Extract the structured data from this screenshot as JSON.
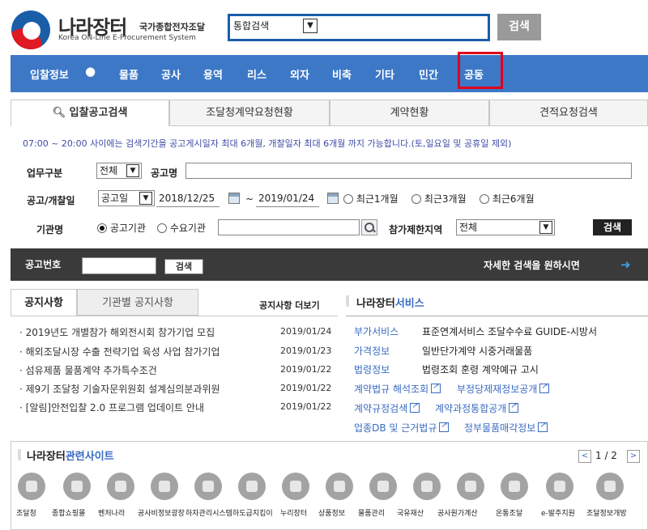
{
  "header": {
    "logo_title": "나라장터",
    "logo_subtitle": "국가종합전자조달",
    "logo_english": "Korea ON-Line E-Procurement System",
    "search_select": "통합검색",
    "search_value": "",
    "search_button": "검색"
  },
  "nav": {
    "items": [
      "입찰정보",
      "물품",
      "공사",
      "용역",
      "리스",
      "외자",
      "비축",
      "기타",
      "민간",
      "공동"
    ],
    "highlighted": "공동",
    "bg_color": "#3d78c7",
    "highlight_color": "#e0001b"
  },
  "tabs": [
    "입찰공고검색",
    "조달청계약요청현황",
    "계약현황",
    "견적요청검색"
  ],
  "search_panel": {
    "notice": "07:00 ~ 20:00 사이에는 검색기간을 공고게시일자 최대 6개월, 개찰일자 최대 6개월 까지 가능합니다.(토,일요일 및 공휴일 제외)",
    "biz_label": "업무구분",
    "biz_value": "전체",
    "title_label": "공고명",
    "title_value": "",
    "date_label": "공고/개찰일",
    "date_type": "공고일",
    "date_from": "2018/12/25",
    "date_sep": "~",
    "date_to": "2019/01/24",
    "period_options": [
      "최근1개월",
      "최근3개월",
      "최근6개월"
    ],
    "agency_label": "기관명",
    "agency_options": [
      "공고기관",
      "수요기관"
    ],
    "agency_value": "",
    "region_label": "참가제한지역",
    "region_value": "전체",
    "search_button": "검색"
  },
  "notice_bar": {
    "number_label": "공고번호",
    "number_value": "",
    "search_button": "검색",
    "detail_link": "자세한 검색을 원하시면",
    "detail_arrow": "➜"
  },
  "notices": {
    "tabs": [
      "공지사항",
      "기관별 공지사항"
    ],
    "more": "공지사항 더보기",
    "items": [
      {
        "title": "2019년도 개별참가 해외전시회 참가기업 모집",
        "date": "2019/01/24"
      },
      {
        "title": "해외조달시장 수출 전략기업 육성 사업 참가기업",
        "date": "2019/01/23"
      },
      {
        "title": "섬유제품 물품계약 추가특수조건",
        "date": "2019/01/22"
      },
      {
        "title": "제9기 조달청 기술자문위원회 설계심의분과위원",
        "date": "2019/01/22"
      },
      {
        "title": "[알림]안전입찰 2.0 프로그램 업데이트 안내",
        "date": "2019/01/22"
      }
    ]
  },
  "services": {
    "title_main": "나라장터",
    "title_accent": "서비스",
    "rows": [
      {
        "key": "부가서비스",
        "value": "표준연계서비스 조달수수료 GUIDE-시방서"
      },
      {
        "key": "가격정보",
        "value": "일반단가계약 시중거래물품"
      },
      {
        "key": "법령정보",
        "value": "법령조회 훈령 계약예규 고시"
      }
    ],
    "links": [
      "계약법규 해석조회",
      "부정당제재정보공개",
      "계약규정검색",
      "계약과정통합공개",
      "업종DB 및 근거법규",
      "정부물품매각정보"
    ]
  },
  "related": {
    "title_main": "나라장터",
    "title_accent": "관련사이트",
    "page": "1 / 2",
    "prev": "<",
    "next": ">",
    "sites": [
      "조달청",
      "종합쇼핑몰",
      "벤처나라",
      "공사비정보광장",
      "하자관리시스템",
      "하도급지킴이",
      "누리장터",
      "상품정보",
      "물품관리",
      "국유재산",
      "공사원가계산",
      "온통조달",
      "e-발주지원",
      "조달정보개방"
    ]
  }
}
